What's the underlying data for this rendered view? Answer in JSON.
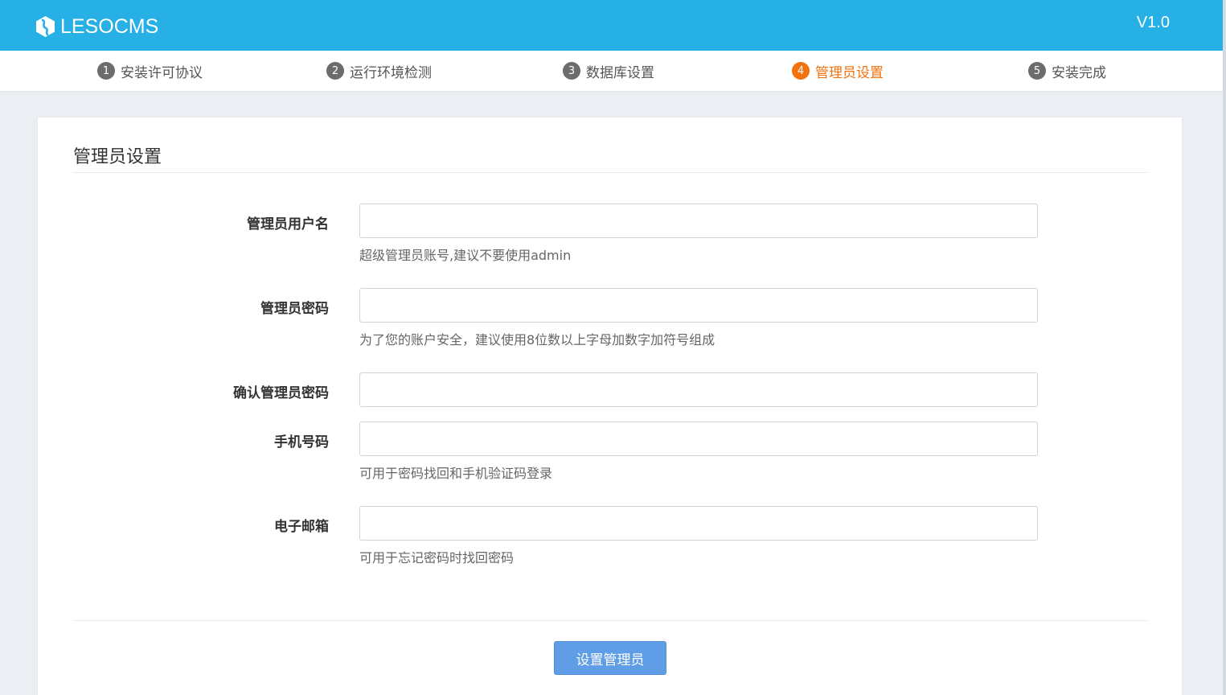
{
  "app": {
    "logo_text": "LESOCMS",
    "version": "V1.0"
  },
  "steps": [
    {
      "num": "1",
      "label": "安装许可协议",
      "active": false
    },
    {
      "num": "2",
      "label": "运行环境检测",
      "active": false
    },
    {
      "num": "3",
      "label": "数据库设置",
      "active": false
    },
    {
      "num": "4",
      "label": "管理员设置",
      "active": true
    },
    {
      "num": "5",
      "label": "安装完成",
      "active": false
    }
  ],
  "form": {
    "title": "管理员设置",
    "username": {
      "label": "管理员用户名",
      "value": "",
      "hint": "超级管理员账号,建议不要使用admin"
    },
    "password": {
      "label": "管理员密码",
      "value": "",
      "hint": "为了您的账户安全，建议使用8位数以上字母加数字加符号组成"
    },
    "confirm_password": {
      "label": "确认管理员密码",
      "value": ""
    },
    "phone": {
      "label": "手机号码",
      "value": "",
      "hint": "可用于密码找回和手机验证码登录"
    },
    "email": {
      "label": "电子邮箱",
      "value": "",
      "hint": "可用于忘记密码时找回密码"
    },
    "submit_label": "设置管理员"
  },
  "colors": {
    "topbar": "#27b0e6",
    "active_step": "#f2720e",
    "step_badge": "#6c6c6c",
    "submit_button": "#5f9ee6"
  }
}
